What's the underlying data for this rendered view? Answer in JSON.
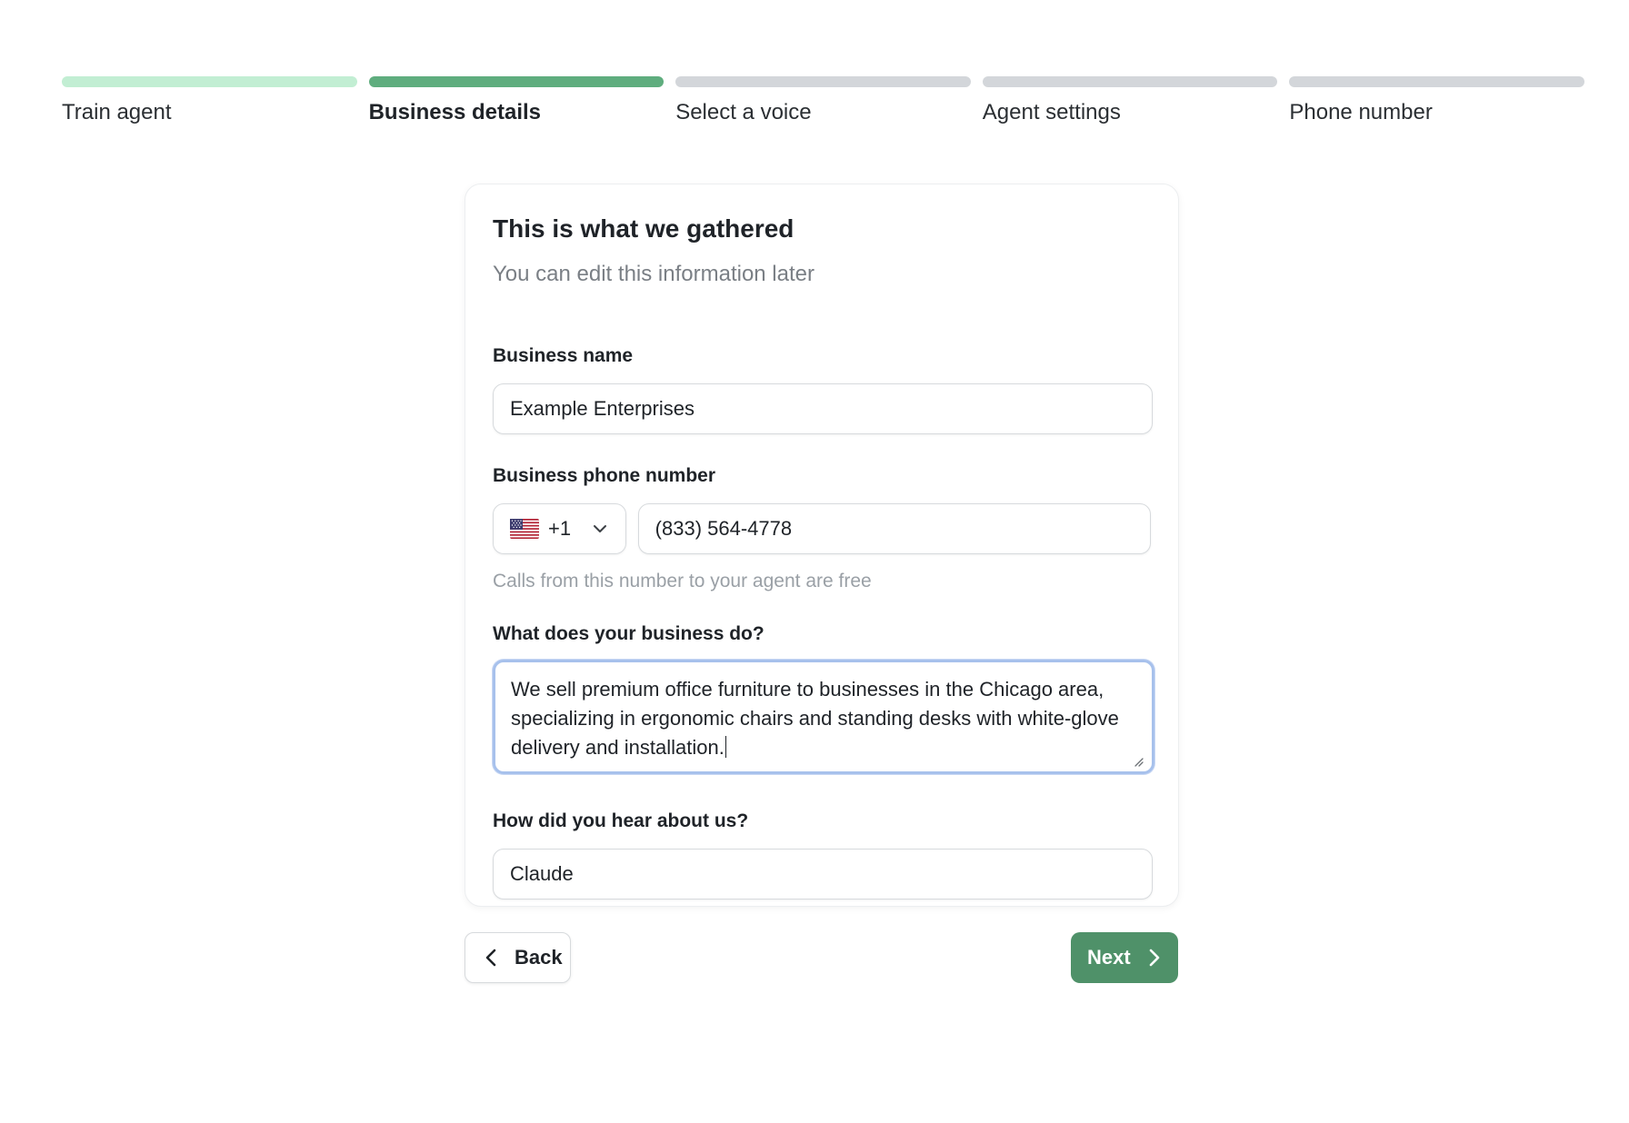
{
  "stepper": {
    "steps": [
      {
        "label": "Train agent",
        "state": "done"
      },
      {
        "label": "Business details",
        "state": "active"
      },
      {
        "label": "Select a voice",
        "state": "pending"
      },
      {
        "label": "Agent settings",
        "state": "pending"
      },
      {
        "label": "Phone number",
        "state": "pending"
      }
    ]
  },
  "card": {
    "title": "This is what we gathered",
    "subtitle": "You can edit this information later"
  },
  "form": {
    "business_name": {
      "label": "Business name",
      "value": "Example Enterprises"
    },
    "phone": {
      "label": "Business phone number",
      "country_icon": "us-flag-icon",
      "dial_code": "+1",
      "value": "(833) 564-4778",
      "hint": "Calls from this number to your agent are free"
    },
    "business_description": {
      "label": "What does your business do?",
      "value": "We sell premium office furniture to businesses in the Chicago area, specializing in ergonomic chairs and standing desks with white-glove delivery and installation."
    },
    "referral": {
      "label": "How did you hear about us?",
      "value": "Claude"
    }
  },
  "nav": {
    "back_label": "Back",
    "next_label": "Next"
  },
  "colors": {
    "accent": "#4f9169",
    "step_active": "#5fad7e",
    "step_done": "#c2eed3",
    "step_pending": "#d3d6da",
    "focus_ring": "#a7c1ec"
  }
}
